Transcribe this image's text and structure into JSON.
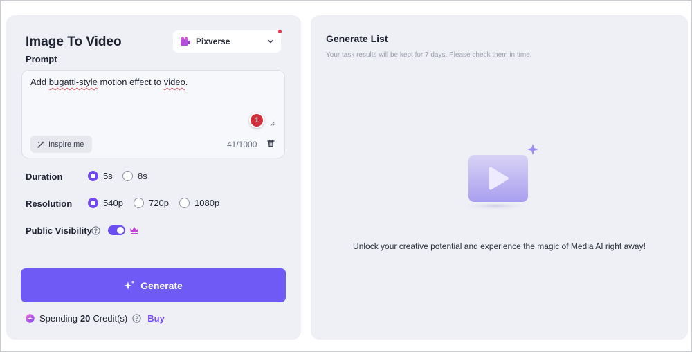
{
  "left": {
    "title": "Image To Video",
    "model": {
      "label": "Pixverse",
      "has_notification": true
    },
    "prompt": {
      "label": "Prompt",
      "segments": [
        "Add ",
        "bugatti-style",
        " motion effect to ",
        "video",
        "."
      ],
      "badge": "1",
      "inspire_label": "Inspire me",
      "char_count": "41/1000"
    },
    "duration": {
      "label": "Duration",
      "options": [
        "5s",
        "8s"
      ],
      "selected": "5s"
    },
    "resolution": {
      "label": "Resolution",
      "options": [
        "540p",
        "720p",
        "1080p"
      ],
      "selected": "540p"
    },
    "visibility": {
      "label": "Public Visibility",
      "enabled": true
    },
    "generate_label": "Generate",
    "spending": {
      "prefix": "Spending",
      "amount": "20",
      "suffix": "Credit(s)",
      "buy_label": "Buy"
    }
  },
  "right": {
    "title": "Generate List",
    "subtitle": "Your task results will be kept for 7 days. Please check them in time.",
    "empty_message": "Unlock your creative potential and experience the magic of Media AI right away!"
  },
  "colors": {
    "accent": "#6f5af6",
    "radio_selected": "#7447f5",
    "badge": "#d12d3a",
    "panel_bg": "#eef0f5"
  },
  "icons": {
    "model": "pixverse-logo-icon",
    "dropdown": "chevron-down-icon",
    "inspire": "magic-wand-icon",
    "delete": "trash-icon",
    "help": "help-circle-icon",
    "premium": "crown-icon",
    "generate": "sparkle-icon",
    "credits": "credit-coin-icon",
    "empty": "video-play-icon"
  }
}
